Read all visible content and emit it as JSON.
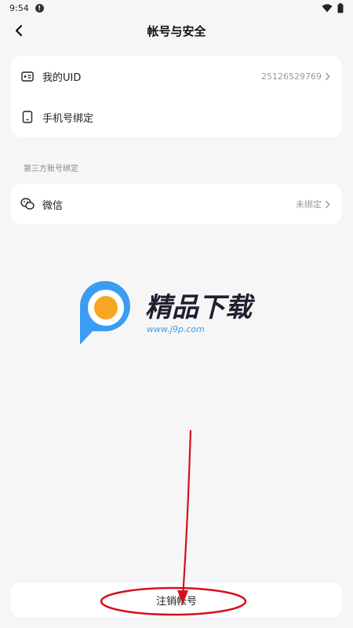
{
  "status_bar": {
    "time": "9:54",
    "icons": [
      "info-icon",
      "wifi-icon",
      "battery-icon"
    ]
  },
  "header": {
    "title": "帐号与安全",
    "back_icon": "back-arrow-icon"
  },
  "account_section": {
    "items": [
      {
        "label": "我的UID",
        "value": "25126529769",
        "icon": "id-card-icon"
      },
      {
        "label": "手机号绑定",
        "value": "",
        "icon": "phone-icon"
      }
    ]
  },
  "third_party_section": {
    "title": "第三方账号绑定",
    "items": [
      {
        "label": "微信",
        "value": "未绑定",
        "icon": "wechat-icon"
      }
    ]
  },
  "watermark": {
    "brand": "精品下载",
    "url": "www.j9p.com"
  },
  "bottom": {
    "cancel_account_label": "注销帐号"
  },
  "colors": {
    "background": "#f6f6f6",
    "card": "#ffffff",
    "annotation": "#d6101a",
    "logo_blue": "#3a9cf2",
    "logo_orange": "#f6a623"
  }
}
